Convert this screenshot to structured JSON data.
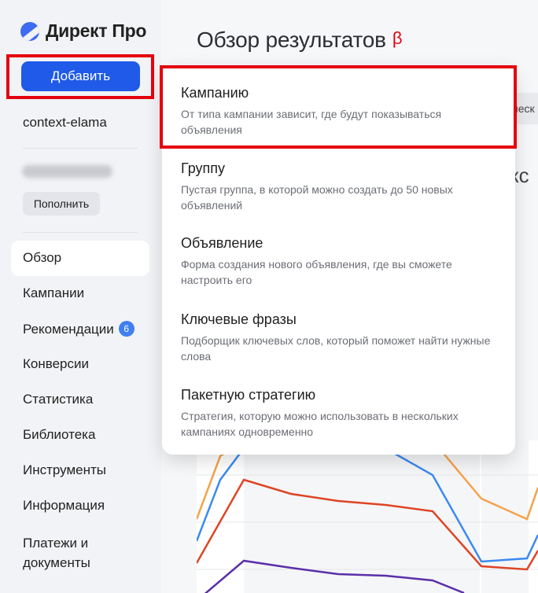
{
  "sidebar": {
    "logo_text": "Директ Про",
    "add_button": "Добавить",
    "account": "context-elama",
    "topup_button": "Пополнить",
    "nav": [
      {
        "label": "Обзор"
      },
      {
        "label": "Кампании"
      },
      {
        "label": "Рекомендации",
        "badge": "6"
      },
      {
        "label": "Конверсии"
      },
      {
        "label": "Статистика"
      },
      {
        "label": "Библиотека"
      },
      {
        "label": "Инструменты"
      },
      {
        "label": "Информация"
      },
      {
        "label": "Платежи и документы"
      }
    ]
  },
  "header": {
    "title": "Обзор результатов",
    "beta": "β"
  },
  "background_fragments": {
    "chip_text": "неск",
    "big_text": "кс"
  },
  "add_menu": {
    "items": [
      {
        "title": "Кампанию",
        "desc": "От типа кампании зависит, где будут показываться объявления"
      },
      {
        "title": "Группу",
        "desc": "Пустая группа, в которой можно создать до 50 новых объявлений"
      },
      {
        "title": "Объявление",
        "desc": "Форма создания нового объявления, где вы сможете настроить его"
      },
      {
        "title": "Ключевые фразы",
        "desc": "Подборщик ключевых слов, который поможет найти нужные слова"
      },
      {
        "title": "Пакетную стратегию",
        "desc": "Стратегия, которую можно использовать в нескольких кампаниях одновременно"
      }
    ]
  },
  "colors": {
    "accent": "#1f5ae8",
    "highlight": "#e5000f",
    "badge": "#3f7ff0",
    "series_orange": "#f4a24a",
    "series_blue": "#3b8af0",
    "series_red": "#de4524",
    "series_purple": "#5b2fa8"
  }
}
